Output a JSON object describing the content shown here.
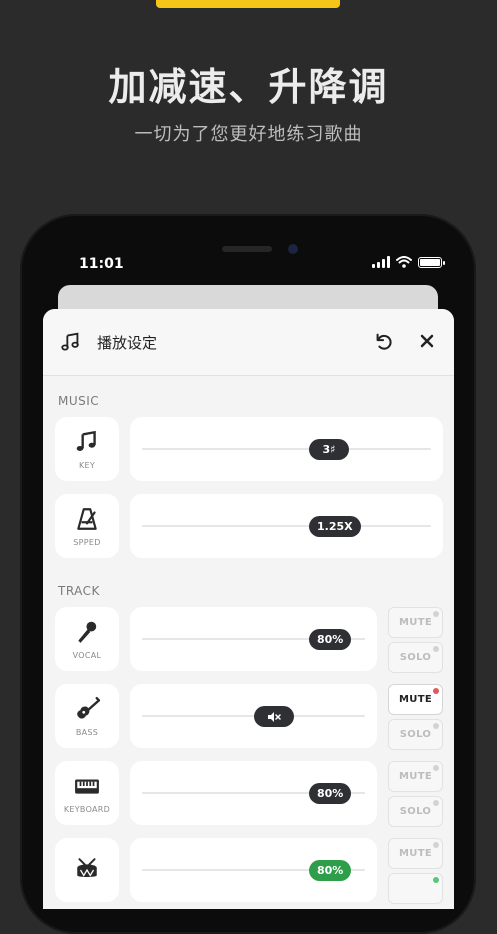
{
  "hero": {
    "title": "加减速、升降调",
    "subtitle": "一切为了您更好地练习歌曲"
  },
  "status_bar": {
    "time": "11:01"
  },
  "sheet": {
    "title": "播放设定",
    "sections": {
      "music": "MUSIC",
      "track": "TRACK"
    },
    "music_rows": [
      {
        "icon": "music-note-icon",
        "label": "KEY",
        "value": "3♯",
        "level": 0.67
      },
      {
        "icon": "metronome-icon",
        "label": "SPPED",
        "value": "1.25X",
        "level": 0.67
      }
    ],
    "track_rows": [
      {
        "icon": "microphone-icon",
        "label": "VOCAL",
        "value": "80%",
        "level": 0.8,
        "mute": "MUTE",
        "solo": "SOLO",
        "mute_active": false,
        "solo_active": false
      },
      {
        "icon": "guitar-icon",
        "label": "BASS",
        "value": "mute-speaker-icon",
        "level": 0.5,
        "mute": "MUTE",
        "solo": "SOLO",
        "mute_active": true,
        "solo_active": false
      },
      {
        "icon": "keyboard-icon",
        "label": "KEYBOARD",
        "value": "80%",
        "level": 0.8,
        "mute": "MUTE",
        "solo": "SOLO",
        "mute_active": false,
        "solo_active": false
      },
      {
        "icon": "drum-icon",
        "label": "",
        "value": "80%",
        "level": 0.8,
        "mute": "MUTE",
        "solo": "",
        "mute_active": false,
        "solo_active": true
      }
    ]
  },
  "colors": {
    "accent_yellow": "#f5c518",
    "thumb_dark": "#2f3033",
    "thumb_green": "#2e9e4a",
    "mute_red": "#e05a5a",
    "solo_green": "#58c878"
  }
}
